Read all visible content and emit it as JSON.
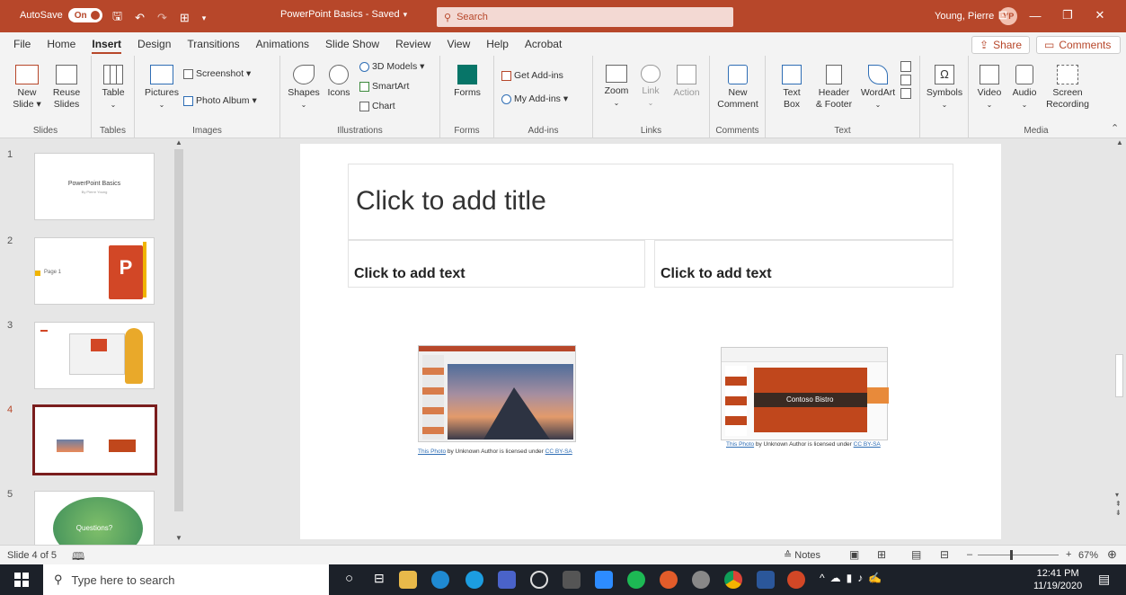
{
  "titlebar": {
    "autosave_label": "AutoSave",
    "autosave_state": "On",
    "doc_title": "PowerPoint Basics - Saved",
    "doc_title_caret": "▾",
    "search_placeholder": "Search",
    "user_name": "Young, Pierre",
    "user_initials": "YP"
  },
  "tabs": [
    "File",
    "Home",
    "Insert",
    "Design",
    "Transitions",
    "Animations",
    "Slide Show",
    "Review",
    "View",
    "Help",
    "Acrobat"
  ],
  "active_tab": "Insert",
  "share_label": "Share",
  "comments_label": "Comments",
  "ribbon": {
    "slides": {
      "new": "New",
      "new2": "Slide ▾",
      "reuse": "Reuse",
      "reuse2": "Slides",
      "label": "Slides"
    },
    "tables": {
      "table": "Table",
      "label": "Tables"
    },
    "images": {
      "pictures": "Pictures",
      "screenshot": "Screenshot ▾",
      "photo_album": "Photo Album ▾",
      "label": "Images"
    },
    "illustrations": {
      "shapes": "Shapes",
      "icons": "Icons",
      "models": "3D Models ▾",
      "smartart": "SmartArt",
      "chart": "Chart",
      "label": "Illustrations"
    },
    "forms": {
      "forms": "Forms",
      "label": "Forms"
    },
    "addins": {
      "get": "Get Add-ins",
      "my": "My Add-ins ▾",
      "label": "Add-ins"
    },
    "links": {
      "zoom": "Zoom",
      "link": "Link",
      "action": "Action",
      "label": "Links"
    },
    "comments": {
      "new": "New",
      "new2": "Comment",
      "label": "Comments"
    },
    "text": {
      "textbox": "Text",
      "textbox2": "Box",
      "header": "Header",
      "header2": "& Footer",
      "wordart": "WordArt",
      "label": "Text"
    },
    "symbols": {
      "symbols": "Symbols"
    },
    "media": {
      "video": "Video",
      "audio": "Audio",
      "screen": "Screen",
      "screen2": "Recording",
      "label": "Media"
    }
  },
  "thumbnails": [
    {
      "num": "1",
      "text": "PowerPoint Basics",
      "sub": "By Pierre Young"
    },
    {
      "num": "2",
      "text": "Page 1"
    },
    {
      "num": "3"
    },
    {
      "num": "4"
    },
    {
      "num": "5",
      "text": "Questions?"
    }
  ],
  "slide": {
    "title_placeholder": "Click to add title",
    "left_placeholder": "Click to add text",
    "right_placeholder": "Click to add text",
    "left_caption_link": "This Photo",
    "left_caption_mid": " by Unknown Author is licensed under ",
    "left_caption_license": "CC BY-SA",
    "right_caption_link": "This Photo",
    "right_caption_mid": " by Unknown Author is licensed under ",
    "right_caption_license": "CC BY-SA",
    "right_image_title": "Contoso Bistro"
  },
  "status": {
    "slide_of": "Slide 4 of 5",
    "notes": "Notes",
    "zoom": "67%"
  },
  "taskbar": {
    "search_placeholder": "Type here to search",
    "time": "12:41 PM",
    "date": "11/19/2020"
  },
  "colors": {
    "accent": "#b7472a",
    "selected_thumb": "#7a1d1d",
    "taskbar": "#1c2129"
  }
}
